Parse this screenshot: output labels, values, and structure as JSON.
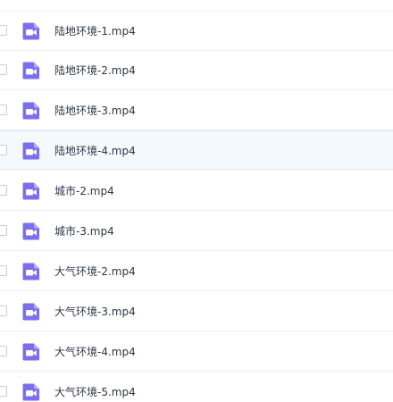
{
  "file_list": {
    "items": [
      {
        "name": "陆地环境-1.mp4",
        "icon": "video-file-icon",
        "selected": false,
        "highlighted": false
      },
      {
        "name": "陆地环境-2.mp4",
        "icon": "video-file-icon",
        "selected": false,
        "highlighted": false
      },
      {
        "name": "陆地环境-3.mp4",
        "icon": "video-file-icon",
        "selected": false,
        "highlighted": false
      },
      {
        "name": "陆地环境-4.mp4",
        "icon": "video-file-icon",
        "selected": false,
        "highlighted": true
      },
      {
        "name": "城市-2.mp4",
        "icon": "video-file-icon",
        "selected": false,
        "highlighted": false
      },
      {
        "name": "城市-3.mp4",
        "icon": "video-file-icon",
        "selected": false,
        "highlighted": false
      },
      {
        "name": "大气环境-2.mp4",
        "icon": "video-file-icon",
        "selected": false,
        "highlighted": false
      },
      {
        "name": "大气环境-3.mp4",
        "icon": "video-file-icon",
        "selected": false,
        "highlighted": false
      },
      {
        "name": "大气环境-4.mp4",
        "icon": "video-file-icon",
        "selected": false,
        "highlighted": false
      },
      {
        "name": "大气环境-5.mp4",
        "icon": "video-file-icon",
        "selected": false,
        "highlighted": false
      }
    ]
  },
  "colors": {
    "video_icon": "#7b6ff0",
    "highlight_row": "#f4f9fe",
    "text": "#2f3744"
  }
}
